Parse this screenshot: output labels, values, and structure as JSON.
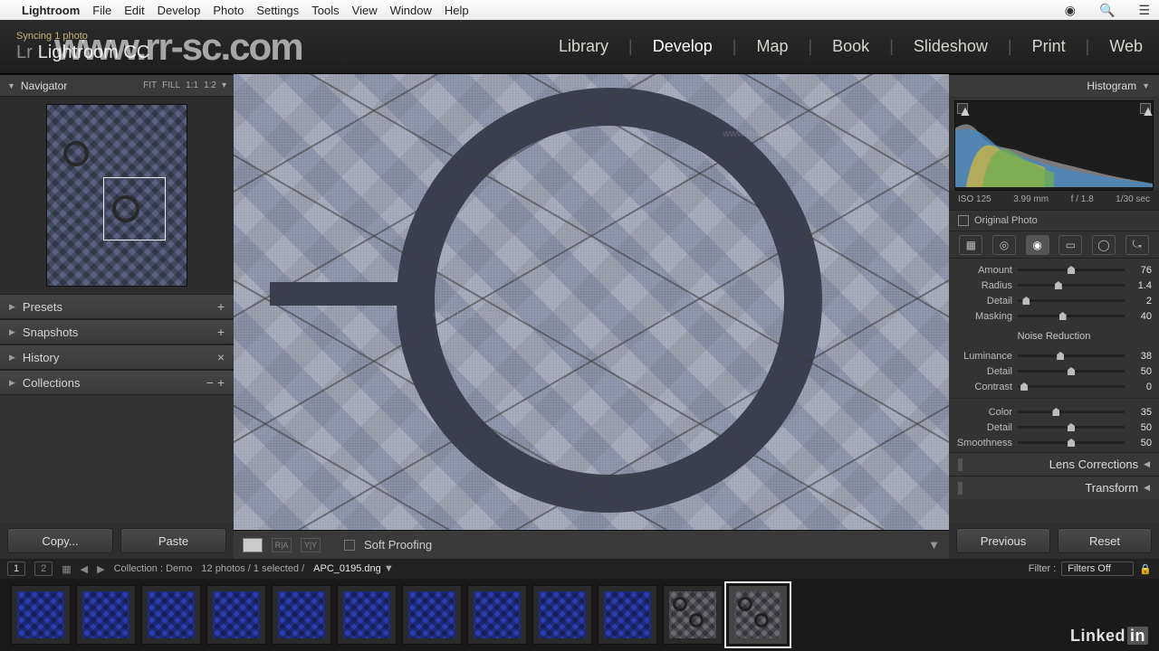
{
  "menubar": {
    "app": "Lightroom",
    "items": [
      "File",
      "Edit",
      "Develop",
      "Photo",
      "Settings",
      "Tools",
      "View",
      "Window",
      "Help"
    ]
  },
  "header": {
    "sync_status": "Syncing 1 photo",
    "product": "Lightroom CC",
    "modules": [
      "Library",
      "Develop",
      "Map",
      "Book",
      "Slideshow",
      "Print",
      "Web"
    ],
    "active_module": "Develop"
  },
  "navigator": {
    "title": "Navigator",
    "zoom_opts": [
      "FIT",
      "FILL",
      "1:1",
      "1:2"
    ]
  },
  "left_sections": [
    {
      "label": "Presets",
      "tail": "+"
    },
    {
      "label": "Snapshots",
      "tail": "+"
    },
    {
      "label": "History",
      "tail": "×"
    },
    {
      "label": "Collections",
      "tail": "− +"
    }
  ],
  "left_buttons": {
    "copy": "Copy...",
    "paste": "Paste"
  },
  "toolbar": {
    "soft_proof": "Soft Proofing"
  },
  "histogram": {
    "title": "Histogram",
    "exif": {
      "iso": "ISO 125",
      "focal": "3.99 mm",
      "aperture": "f / 1.8",
      "shutter": "1/30 sec"
    },
    "original_label": "Original Photo"
  },
  "detail": {
    "sharpening": [
      {
        "label": "Amount",
        "value": "76",
        "pos": 50
      },
      {
        "label": "Radius",
        "value": "1.4",
        "pos": 38
      },
      {
        "label": "Detail",
        "value": "2",
        "pos": 8
      },
      {
        "label": "Masking",
        "value": "40",
        "pos": 42
      }
    ],
    "nr_title": "Noise Reduction",
    "noise": [
      {
        "label": "Luminance",
        "value": "38",
        "pos": 40
      },
      {
        "label": "Detail",
        "value": "50",
        "pos": 50
      },
      {
        "label": "Contrast",
        "value": "0",
        "pos": 6
      }
    ],
    "color": [
      {
        "label": "Color",
        "value": "35",
        "pos": 36
      },
      {
        "label": "Detail",
        "value": "50",
        "pos": 50
      },
      {
        "label": "Smoothness",
        "value": "50",
        "pos": 50
      }
    ]
  },
  "right_sections": [
    {
      "label": "Lens Corrections"
    },
    {
      "label": "Transform"
    }
  ],
  "right_buttons": {
    "prev": "Previous",
    "reset": "Reset"
  },
  "filmstrip": {
    "pages": [
      "1",
      "2"
    ],
    "collection": "Collection : Demo",
    "count": "12 photos / 1 selected /",
    "filename": "APC_0195.dng",
    "filter_label": "Filter :",
    "filter_value": "Filters Off",
    "thumb_count": 12,
    "selected_index": 11
  },
  "watermark": "www.rr-sc.com",
  "brand": "Linked"
}
